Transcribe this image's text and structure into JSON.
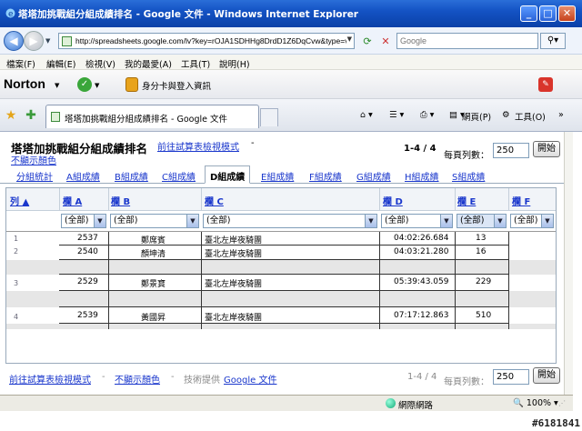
{
  "window": {
    "title": "塔塔加挑戰組分組成績排名 - Google 文件 - Windows Internet Explorer"
  },
  "address": {
    "url": "http://spreadsheets.google.com/lv?key=rOJA1SDHHg8DrdD1Z6DqCvw&type=v",
    "search_placeholder": "Google"
  },
  "menu": [
    "檔案(F)",
    "編輯(E)",
    "檢視(V)",
    "我的最愛(A)",
    "工具(T)",
    "說明(H)"
  ],
  "toolbar": {
    "norton": "Norton",
    "idsafe": "身分卡與登入資訊"
  },
  "tab": {
    "label": "塔塔加挑戰組分組成績排名 - Google 文件"
  },
  "commands": {
    "page": "網頁(P)",
    "tools": "工具(O)"
  },
  "page": {
    "title": "塔塔加挑戰組分組成績排名",
    "goto_edit": "前往試算表檢視模式",
    "dash": "-",
    "show_colors": "不顯示顏色",
    "range": "1-4 / 4",
    "rows_label": "每頁列數：",
    "rows_value": "250",
    "go": "開始"
  },
  "sheet_tabs": [
    "分組統計",
    "A組成績",
    "B組成績",
    "C組成績",
    "D組成績",
    "E組成績",
    "F組成績",
    "G組成績",
    "H組成績",
    "S組成績"
  ],
  "active_sheet": 4,
  "columns": {
    "row": "列 ▲",
    "A": "欄 A",
    "B": "欄 B",
    "C": "欄 C",
    "D": "欄 D",
    "E": "欄 E",
    "F": "欄 F"
  },
  "filter": {
    "all": "(全部)"
  },
  "rows": [
    {
      "num": "1",
      "a": "2537",
      "b": "鄭席賓",
      "c": "臺北左岸夜騎團",
      "d": "04:02:26.684",
      "e": "13"
    },
    {
      "num": "2",
      "a": "2540",
      "b": "顏坤清",
      "c": "臺北左岸夜騎團",
      "d": "04:03:21.280",
      "e": "16"
    },
    {
      "num": "3",
      "a": "2529",
      "b": "鄭景寶",
      "c": "臺北左岸夜騎團",
      "d": "05:39:43.059",
      "e": "229"
    },
    {
      "num": "4",
      "a": "2539",
      "b": "黃國昇",
      "c": "臺北左岸夜騎團",
      "d": "07:17:12.863",
      "e": "510"
    }
  ],
  "footer": {
    "goto_edit": "前往試算表檢視模式",
    "dash": "-",
    "show_colors": "不顯示顏色",
    "powered_prefix": "技術提供",
    "powered_link": "Google 文件",
    "range": "1-4 / 4",
    "rows_label": "每頁列數：",
    "rows_value": "250",
    "go": "開始"
  },
  "status": {
    "zone": "網際網路",
    "zoom": "100%"
  },
  "watermark": "#6181841"
}
